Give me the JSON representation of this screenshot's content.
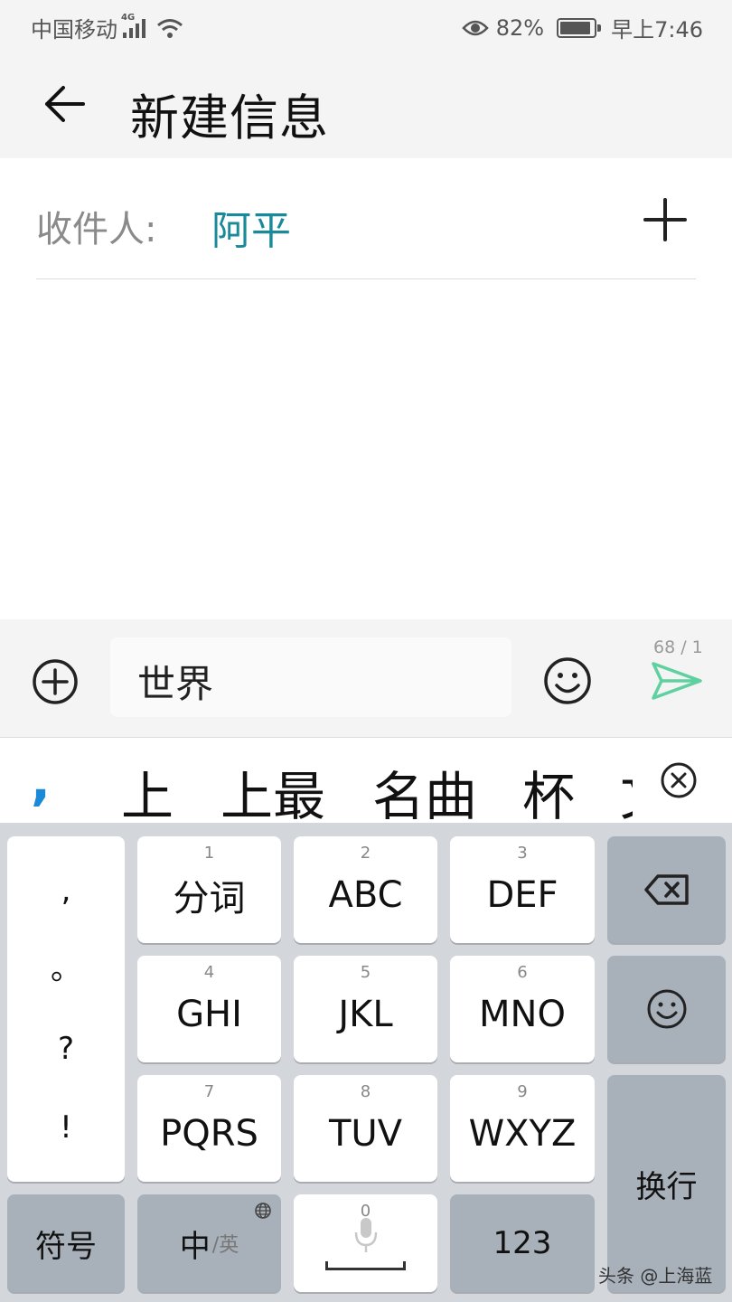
{
  "status": {
    "carrier": "中国移动",
    "network": "4G",
    "battery_percent": "82%",
    "time": "早上7:46"
  },
  "header": {
    "title": "新建信息"
  },
  "recipient": {
    "label": "收件人:",
    "name": "阿平"
  },
  "compose": {
    "text": "世界",
    "counter": "68 / 1"
  },
  "candidates": [
    ",",
    "上",
    "上最",
    "名曲",
    "杯",
    "文"
  ],
  "keyboard": {
    "punctuation": [
      ",",
      "。",
      "?",
      "!"
    ],
    "keys": [
      {
        "num": "1",
        "label": "分词"
      },
      {
        "num": "2",
        "label": "ABC"
      },
      {
        "num": "3",
        "label": "DEF"
      },
      {
        "num": "4",
        "label": "GHI"
      },
      {
        "num": "5",
        "label": "JKL"
      },
      {
        "num": "6",
        "label": "MNO"
      },
      {
        "num": "7",
        "label": "PQRS"
      },
      {
        "num": "8",
        "label": "TUV"
      },
      {
        "num": "9",
        "label": "WXYZ"
      }
    ],
    "enter": "换行",
    "symbols": "符号",
    "lang_primary": "中",
    "lang_secondary": "/英",
    "space_num": "0",
    "numbers": "123"
  },
  "watermark": "头条 @上海蓝",
  "colors": {
    "accent": "#1a8a9a",
    "send": "#5fd0a0",
    "punct_candidate": "#1a8ad8",
    "keyboard_bg": "#d3d6db",
    "dark_key": "#a8b0ba"
  }
}
